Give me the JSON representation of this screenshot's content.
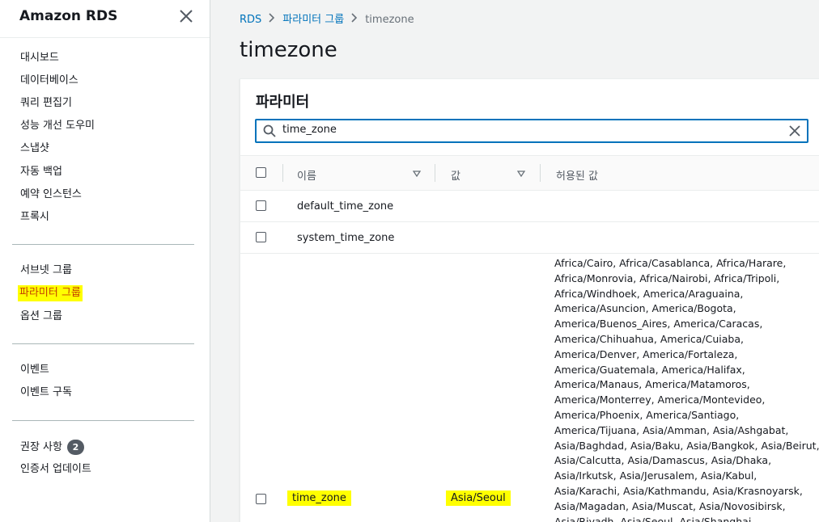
{
  "sidebar": {
    "title": "Amazon RDS",
    "close_icon": "close-icon",
    "group1": [
      "대시보드",
      "데이터베이스",
      "쿼리 편집기",
      "성능 개선 도우미",
      "스냅샷",
      "자동 백업",
      "예약 인스턴스",
      "프록시"
    ],
    "group2": [
      "서브넷 그룹",
      "파라미터 그룹",
      "옵션 그룹"
    ],
    "group3": [
      "이벤트",
      "이벤트 구독"
    ],
    "recommendations_label": "권장 사항",
    "recommendations_count": "2",
    "cert_update_label": "인증서 업데이트",
    "highlight_color": "#ffff00"
  },
  "breadcrumb": {
    "rds": "RDS",
    "param_groups": "파라미터 그룹",
    "current": "timezone"
  },
  "page": {
    "title": "timezone"
  },
  "panel": {
    "title": "파라미터",
    "search": {
      "value": "time_zone",
      "icon": "search-icon",
      "clear_icon": "close-icon"
    },
    "columns": {
      "name": "이름",
      "value": "값",
      "allowed": "허용된 값"
    },
    "rows": [
      {
        "name": "default_time_zone",
        "value": "",
        "allowed": ""
      },
      {
        "name": "system_time_zone",
        "value": "",
        "allowed": ""
      },
      {
        "name": "time_zone",
        "value": "Asia/Seoul",
        "allowed": "Africa/Cairo, Africa/Casablanca, Africa/Harare, Africa/Monrovia, Africa/Nairobi, Africa/Tripoli, Africa/Windhoek, America/Araguaina, America/Asuncion, America/Bogota, America/Buenos_Aires, America/Caracas, America/Chihuahua, America/Cuiaba, America/Denver, America/Fortaleza, America/Guatemala, America/Halifax, America/Manaus, America/Matamoros, America/Monterrey, America/Montevideo, America/Phoenix, America/Santiago, America/Tijuana, Asia/Amman, Asia/Ashgabat, Asia/Baghdad, Asia/Baku, Asia/Bangkok, Asia/Beirut, Asia/Calcutta, Asia/Damascus, Asia/Dhaka, Asia/Irkutsk, Asia/Jerusalem, Asia/Kabul, Asia/Karachi, Asia/Kathmandu, Asia/Krasnoyarsk, Asia/Magadan, Asia/Muscat, Asia/Novosibirsk, Asia/Riyadh, Asia/Seoul, Asia/Shanghai"
      }
    ]
  }
}
